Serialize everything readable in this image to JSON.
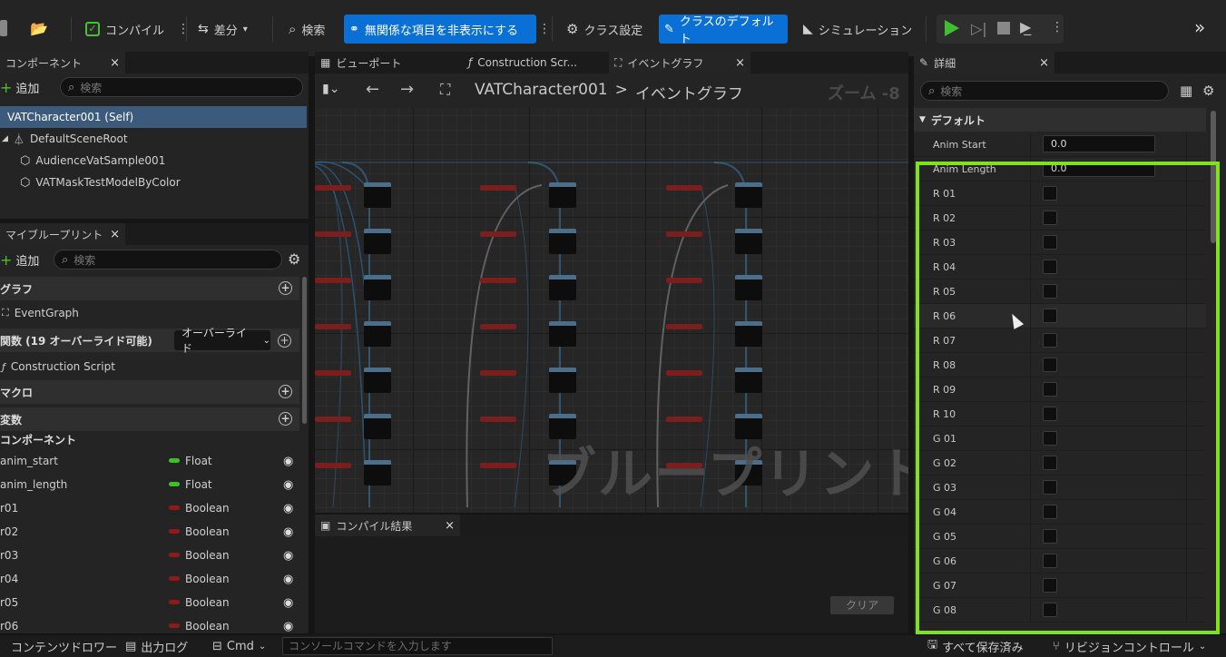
{
  "toolbar": {
    "compile": "コンパイル",
    "diff": "差分",
    "search": "検索",
    "hide_unrelated": "無関係な項目を非表示にする",
    "class_settings": "クラス設定",
    "class_defaults": "クラスのデフォルト",
    "simulation": "シミュレーション"
  },
  "components": {
    "tab": "コンポーネント",
    "add": "追加",
    "search_placeholder": "検索",
    "items": [
      "VATCharacter001 (Self)",
      "DefaultSceneRoot",
      "AudienceVatSample001",
      "VATMaskTestModelByColor"
    ]
  },
  "mybp": {
    "tab": "マイブループリント",
    "add": "追加",
    "search_placeholder": "検索",
    "graphs_header": "グラフ",
    "event_graph": "EventGraph",
    "functions_header": "関数 (19 オーバーライド可能)",
    "override": "オーバーライド",
    "construction_script": "Construction Script",
    "macros_header": "マクロ",
    "variables_header": "変数",
    "component_group": "コンポーネント",
    "variables": [
      {
        "name": "anim_start",
        "type": "Float",
        "color": "#40c020"
      },
      {
        "name": "anim_length",
        "type": "Float",
        "color": "#40c020"
      },
      {
        "name": "r01",
        "type": "Boolean",
        "color": "#8e1a1a"
      },
      {
        "name": "r02",
        "type": "Boolean",
        "color": "#8e1a1a"
      },
      {
        "name": "r03",
        "type": "Boolean",
        "color": "#8e1a1a"
      },
      {
        "name": "r04",
        "type": "Boolean",
        "color": "#8e1a1a"
      },
      {
        "name": "r05",
        "type": "Boolean",
        "color": "#8e1a1a"
      },
      {
        "name": "r06",
        "type": "Boolean",
        "color": "#8e1a1a"
      }
    ]
  },
  "editor_tabs": [
    "ビューポート",
    "Construction Scr...",
    "イベントグラフ"
  ],
  "graph": {
    "breadcrumb_root": "VATCharacter001",
    "breadcrumb_sep": ">",
    "breadcrumb_leaf": "イベントグラフ",
    "zoom": "ズーム -8",
    "watermark": "ブループリント"
  },
  "compile_results": {
    "tab": "コンパイル結果",
    "clear": "クリア"
  },
  "details": {
    "tab": "詳細",
    "search_placeholder": "検索",
    "category": "デフォルト",
    "rows": [
      {
        "label": "Anim Start",
        "value": "0.0"
      },
      {
        "label": "Anim Length",
        "value": "0.0"
      },
      {
        "label": "R 01"
      },
      {
        "label": "R 02"
      },
      {
        "label": "R 03"
      },
      {
        "label": "R 04"
      },
      {
        "label": "R 05"
      },
      {
        "label": "R 06"
      },
      {
        "label": "R 07"
      },
      {
        "label": "R 08"
      },
      {
        "label": "R 09"
      },
      {
        "label": "R 10"
      },
      {
        "label": "G 01"
      },
      {
        "label": "G 02"
      },
      {
        "label": "G 03"
      },
      {
        "label": "G 04"
      },
      {
        "label": "G 05"
      },
      {
        "label": "G 06"
      },
      {
        "label": "G 07"
      },
      {
        "label": "G 08"
      }
    ],
    "highlight_color": "#7fe21b"
  },
  "statusbar": {
    "content_drawer": "コンテンツドロワー",
    "output_log": "出力ログ",
    "cmd": "Cmd",
    "console_placeholder": "コンソールコマンドを入力します",
    "save_all": "すべて保存済み",
    "revision_control": "リビジョンコントロール"
  }
}
